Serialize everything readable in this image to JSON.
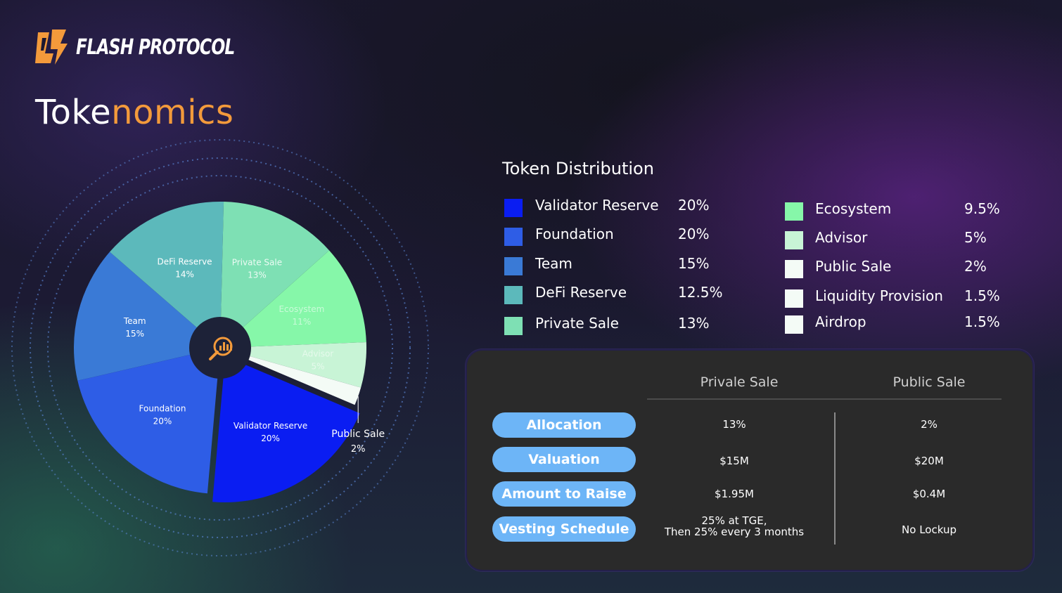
{
  "brand": {
    "name": "FLASH PROTOCOL",
    "accent": "#f39a3b"
  },
  "title": {
    "part1": "Toke",
    "part2": "nomics"
  },
  "chart_data": {
    "type": "pie",
    "title": "",
    "center_icon": "chart-search-icon",
    "slices": [
      {
        "name": "Team",
        "label": "15%",
        "value": 15,
        "color": "#3a7ad6"
      },
      {
        "name": "DeFi Reserve",
        "label": "14%",
        "value": 14,
        "color": "#5cb9bb"
      },
      {
        "name": "Private Sale",
        "label": "13%",
        "value": 13,
        "color": "#7ee0b4"
      },
      {
        "name": "Ecosystem",
        "label": "11%",
        "value": 11,
        "color": "#86f7a9"
      },
      {
        "name": "Advisor",
        "label": "5%",
        "value": 5,
        "color": "#c8f4d6"
      },
      {
        "name": "Public Sale",
        "label": "2%",
        "value": 2,
        "color": "#f4fbf6"
      },
      {
        "name": "Validator Reserve",
        "label": "20%",
        "value": 20,
        "color": "#0a1df2",
        "exploded": true
      },
      {
        "name": "Foundation",
        "label": "20%",
        "value": 20,
        "color": "#2e5de6"
      }
    ]
  },
  "distribution": {
    "title": "Token Distribution",
    "left": [
      {
        "label": "Validator Reserve",
        "value": "20%",
        "color": "#0a1df2"
      },
      {
        "label": "Foundation",
        "value": "20%",
        "color": "#2e5de6"
      },
      {
        "label": "Team",
        "value": "15%",
        "color": "#3a7ad6"
      },
      {
        "label": "DeFi Reserve",
        "value": "12.5%",
        "color": "#5cb9bb"
      },
      {
        "label": "Private Sale",
        "value": "13%",
        "color": "#7ee0b4"
      }
    ],
    "right": [
      {
        "label": "Ecosystem",
        "value": "9.5%",
        "color": "#86f7a9"
      },
      {
        "label": "Advisor",
        "value": "5%",
        "color": "#c8f4d6"
      },
      {
        "label": "Public Sale",
        "value": "2%",
        "color": "#f4fbf6"
      },
      {
        "label": "Liquidity Provision",
        "value": "1.5%",
        "color": "#f4fbf6"
      },
      {
        "label": "Airdrop",
        "value": "1.5%",
        "color": "#f4fbf6"
      }
    ]
  },
  "sale_table": {
    "columns": [
      "Privale Sale",
      "Public Sale"
    ],
    "rows": [
      {
        "label": "Allocation",
        "private": "13%",
        "public": "2%"
      },
      {
        "label": "Valuation",
        "private": "$15M",
        "public": "$20M"
      },
      {
        "label": "Amount to Raise",
        "private": "$1.95M",
        "public": "$0.4M"
      },
      {
        "label": "Vesting Schedule",
        "private_line1": "25% at TGE,",
        "private_line2": "Then 25% every 3 months",
        "public": "No Lockup"
      }
    ]
  }
}
